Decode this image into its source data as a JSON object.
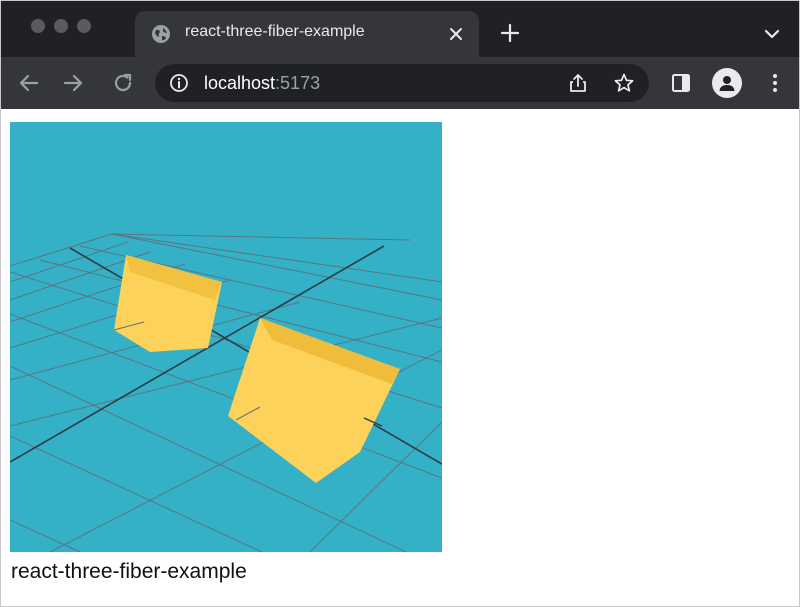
{
  "tab": {
    "title": "react-three-fiber-example"
  },
  "address_bar": {
    "host": "localhost",
    "port": ":5173"
  },
  "page": {
    "caption": "react-three-fiber-example"
  },
  "scene": {
    "background_color": "#34b1c6",
    "box_color": "#fdd25a",
    "grid_color": "#5f6f78"
  },
  "icons": {
    "tab_favicon": "globe-icon",
    "tab_close": "close-icon",
    "new_tab": "plus-icon",
    "tab_search": "chevron-down-icon",
    "back": "arrow-left-icon",
    "forward": "arrow-right-icon",
    "reload": "reload-icon",
    "site_info": "info-icon",
    "share": "share-icon",
    "bookmark": "star-icon",
    "side_panel": "side-panel-icon",
    "profile": "person-icon",
    "menu": "kebab-menu-icon"
  }
}
